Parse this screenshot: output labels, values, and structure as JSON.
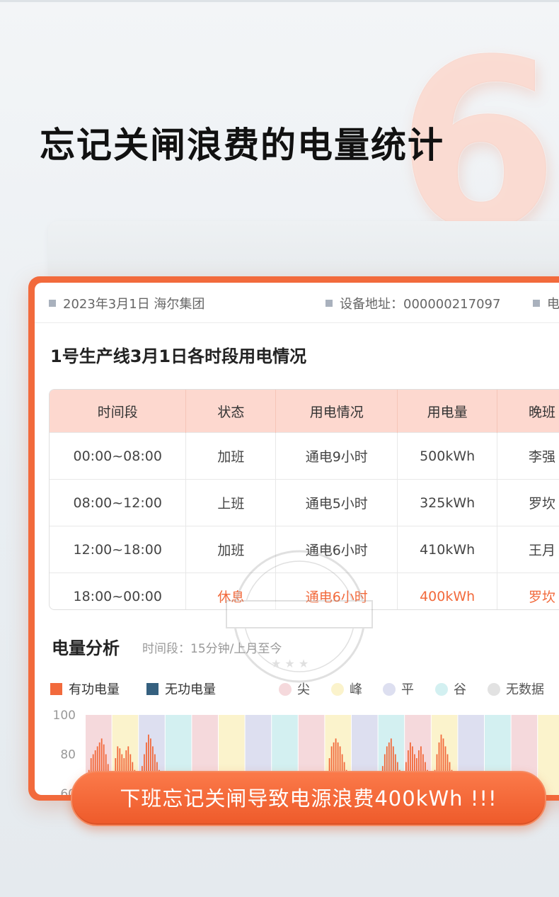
{
  "headline": "忘记关闸浪费的电量统计",
  "big_number": "6",
  "info_bar": {
    "date_company": "2023年3月1日 海尔集团",
    "device_address": "设备地址：000000217097",
    "cut_text": "电"
  },
  "section_title": "1号生产线3月1日各时段用电情况",
  "table": {
    "headers": [
      "时间段",
      "状态",
      "用电情况",
      "用电量",
      "晚班"
    ],
    "rows": [
      {
        "period": "00:00~08:00",
        "status": "加班",
        "usage": "通电9小时",
        "kwh": "500kWh",
        "person": "李强"
      },
      {
        "period": "08:00~12:00",
        "status": "上班",
        "usage": "通电5小时",
        "kwh": "325kWh",
        "person": "罗坎"
      },
      {
        "period": "12:00~18:00",
        "status": "加班",
        "usage": "通电6小时",
        "kwh": "410kWh",
        "person": "王月"
      },
      {
        "period": "18:00~00:00",
        "status": "休息",
        "usage": "通电6小时",
        "kwh": "400kWh",
        "person": "罗坎"
      }
    ]
  },
  "analysis": {
    "title": "电量分析",
    "subtitle": "时间段：15分钟/上月至今",
    "legend": {
      "active": "有功电量",
      "reactive": "无功电量",
      "peak_sharp": "尖",
      "peak": "峰",
      "flat": "平",
      "valley": "谷",
      "no_data": "无数据"
    }
  },
  "colors": {
    "accent": "#f26a3c",
    "active": "#f26a3c",
    "reactive": "#35607f",
    "sharp": "#f5d9dc",
    "peak": "#fbf3cc",
    "flat": "#dddff0",
    "valley": "#d3f0f1",
    "nodata": "#e2e2e2"
  },
  "chart_data": {
    "type": "bar",
    "y_ticks": [
      "100",
      "80",
      "60"
    ],
    "ylim": [
      60,
      100
    ],
    "band_sequence": [
      "sharp",
      "peak",
      "flat",
      "valley",
      "sharp",
      "peak",
      "flat",
      "valley",
      "sharp",
      "peak",
      "flat",
      "valley",
      "sharp",
      "peak",
      "flat",
      "valley",
      "sharp",
      "peak"
    ],
    "bar_clusters": [
      {
        "band": 0,
        "values": [
          68,
          72,
          78,
          80,
          82,
          84,
          86,
          88,
          85,
          80,
          75,
          70
        ]
      },
      {
        "band": 1,
        "values": [
          70,
          78,
          84,
          83,
          80,
          78,
          82,
          84,
          80,
          76,
          72,
          68
        ]
      },
      {
        "band": 2,
        "values": [
          68,
          74,
          80,
          86,
          90,
          88,
          84,
          80,
          76,
          72,
          68,
          65
        ]
      },
      {
        "band": 9,
        "values": [
          70,
          78,
          84,
          86,
          88,
          86,
          84,
          80,
          76,
          72,
          68
        ]
      },
      {
        "band": 11,
        "values": [
          68,
          74,
          80,
          84,
          86,
          88,
          84,
          80,
          76,
          72,
          68
        ]
      },
      {
        "band": 12,
        "values": [
          76,
          82,
          86,
          84,
          80,
          78,
          82,
          84,
          80,
          76,
          72,
          68
        ]
      },
      {
        "band": 13,
        "values": [
          72,
          80,
          86,
          90,
          88,
          84,
          80,
          76,
          72,
          68
        ]
      }
    ]
  },
  "banner_text": "下班忘记关闸导致电源浪费400kWh !!!"
}
